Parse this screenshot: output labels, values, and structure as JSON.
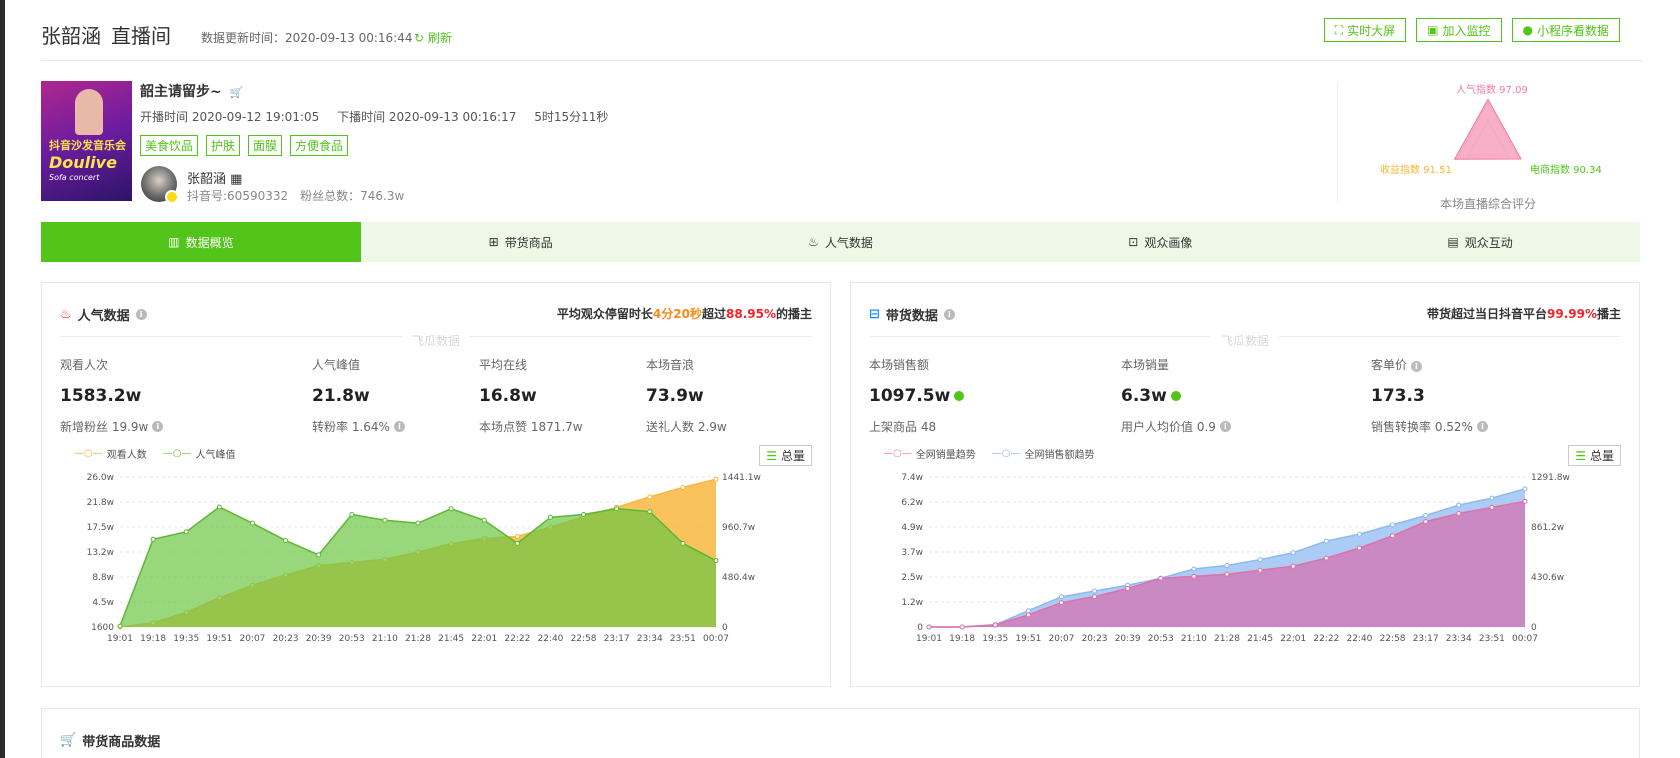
{
  "header": {
    "name": "张韶涵",
    "room": "直播间",
    "update_label": "数据更新时间：",
    "update_time": "2020-09-13 00:16:44",
    "refresh": "刷新",
    "buttons": [
      "实时大屏",
      "加入监控",
      "小程序看数据"
    ]
  },
  "live": {
    "title": "韶主请留步~",
    "cover_text_1": "抖音沙发音乐会",
    "cover_text_2": "Doulive",
    "cover_text_3": "Sofa concert",
    "start_label": "开播时间 2020-09-12 19:01:05",
    "end_label": "下播时间 2020-09-13 00:16:17",
    "duration": "5时15分11秒",
    "tags": [
      "美食饮品",
      "护肤",
      "面膜",
      "方便食品"
    ],
    "anchor_name": "张韶涵",
    "douyin_id": "抖音号:60590332",
    "fans": "粉丝总数：746.3w"
  },
  "score": {
    "popularity": "人气指数 97.09",
    "income": "收益指数 91.51",
    "commerce": "电商指数 90.34",
    "caption": "本场直播综合评分",
    "values": {
      "popularity": 97.09,
      "income": 91.51,
      "commerce": 90.34
    }
  },
  "tabs": [
    "数据概览",
    "带货商品",
    "人气数据",
    "观众画像",
    "观众互动"
  ],
  "watermark": "飞瓜数据",
  "popularity_panel": {
    "title": "人气数据",
    "summary_pre": "平均观众停留时长",
    "summary_time": "4分20秒",
    "summary_mid": "超过",
    "summary_pct": "88.95%",
    "summary_post": "的播主",
    "stats": [
      {
        "label": "观看人次",
        "value": "1583.2w",
        "sub": "新增粉丝 19.9w"
      },
      {
        "label": "人气峰值",
        "value": "21.8w",
        "sub": "转粉率 1.64%"
      },
      {
        "label": "平均在线",
        "value": "16.8w",
        "sub": "本场点赞 1871.7w"
      },
      {
        "label": "本场音浪",
        "value": "73.9w",
        "sub": "送礼人数 2.9w"
      }
    ],
    "legend": [
      "观看人数",
      "人气峰值"
    ],
    "total_btn": "总量"
  },
  "sales_panel": {
    "title": "带货数据",
    "summary_pre": "带货超过当日抖音平台",
    "summary_pct": "99.99%",
    "summary_post": "播主",
    "stats": [
      {
        "label": "本场销售额",
        "value": "1097.5w",
        "sub": "上架商品 48"
      },
      {
        "label": "本场销量",
        "value": "6.3w",
        "sub": "用户人均价值 0.9"
      },
      {
        "label": "客单价",
        "value": "173.3",
        "sub": "销售转换率 0.52%"
      }
    ],
    "legend": [
      "全网销量趋势",
      "全网销售额趋势"
    ],
    "total_btn": "总量"
  },
  "bottom": {
    "title": "带货商品数据"
  },
  "chart_data": [
    {
      "type": "area",
      "x": [
        "19:01",
        "19:18",
        "19:35",
        "19:51",
        "20:07",
        "20:23",
        "20:39",
        "20:53",
        "21:10",
        "21:28",
        "21:45",
        "22:01",
        "22:22",
        "22:40",
        "22:58",
        "23:17",
        "23:34",
        "23:51",
        "00:07"
      ],
      "left_ticks": [
        "1600",
        "4.5w",
        "8.8w",
        "13.2w",
        "17.5w",
        "21.8w",
        "26.0w"
      ],
      "right_ticks": [
        "0",
        "480.4w",
        "960.7w",
        "1441.1w"
      ],
      "ylim": [
        0,
        26.0
      ],
      "y2lim": [
        0,
        1441.1
      ],
      "series": [
        {
          "name": "人气峰值",
          "axis": "left",
          "values": [
            0.16,
            15.2,
            16.5,
            20.8,
            18.0,
            15.0,
            12.5,
            19.5,
            18.5,
            18.0,
            20.5,
            18.5,
            14.5,
            19.0,
            19.5,
            20.5,
            20.0,
            14.5,
            11.5
          ]
        },
        {
          "name": "观看人数",
          "axis": "right",
          "values": [
            0,
            40,
            140,
            280,
            400,
            500,
            590,
            620,
            650,
            720,
            800,
            850,
            870,
            960,
            1060,
            1150,
            1250,
            1340,
            1420
          ]
        }
      ]
    },
    {
      "type": "area",
      "x": [
        "19:01",
        "19:18",
        "19:35",
        "19:51",
        "20:07",
        "20:23",
        "20:39",
        "20:53",
        "21:10",
        "21:28",
        "21:45",
        "22:01",
        "22:22",
        "22:40",
        "22:58",
        "23:17",
        "23:34",
        "23:51",
        "00:07"
      ],
      "left_ticks": [
        "0",
        "1.2w",
        "2.5w",
        "3.7w",
        "4.9w",
        "6.2w",
        "7.4w"
      ],
      "right_ticks": [
        "0",
        "430.6w",
        "861.2w",
        "1291.8w"
      ],
      "ylim": [
        0,
        7.4
      ],
      "y2lim": [
        0,
        1291.8
      ],
      "series": [
        {
          "name": "全网销量趋势",
          "axis": "left",
          "values": [
            0,
            0,
            0.1,
            0.6,
            1.2,
            1.5,
            1.9,
            2.4,
            2.5,
            2.6,
            2.8,
            3.0,
            3.4,
            3.9,
            4.5,
            5.2,
            5.6,
            5.9,
            6.2
          ]
        },
        {
          "name": "全网销售额趋势",
          "axis": "right",
          "values": [
            0,
            0,
            20,
            140,
            260,
            310,
            360,
            420,
            500,
            530,
            580,
            640,
            740,
            800,
            880,
            960,
            1050,
            1110,
            1190
          ]
        }
      ]
    }
  ]
}
